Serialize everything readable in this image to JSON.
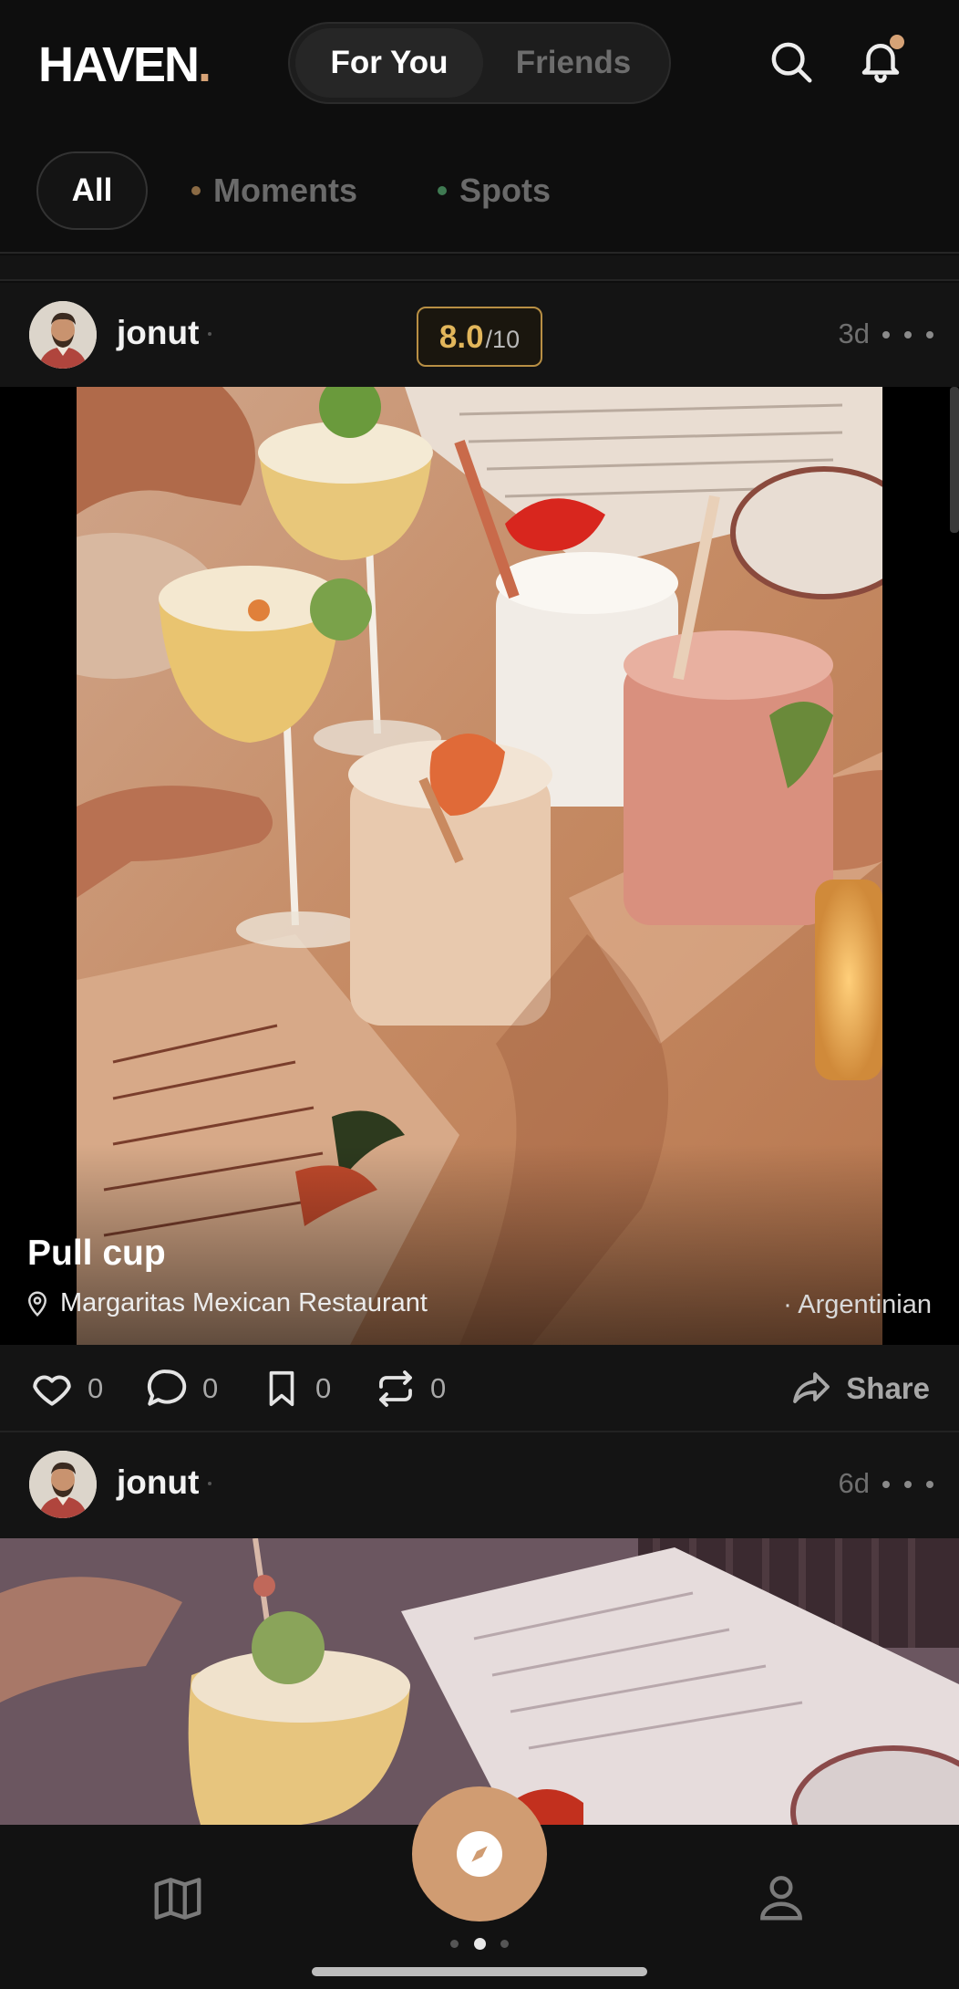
{
  "app": {
    "logo_text": "HAVEN",
    "logo_dot": ".",
    "accent": "#d6a276"
  },
  "header": {
    "tabs": [
      {
        "label": "For You",
        "active": true
      },
      {
        "label": "Friends",
        "active": false
      }
    ],
    "icons": [
      "search-icon",
      "bell-icon"
    ],
    "notification_dot": true
  },
  "filters": [
    {
      "label": "All",
      "active": true
    },
    {
      "label": "Moments",
      "bullet_color": "#8a6a44"
    },
    {
      "label": "Spots",
      "bullet_color": "#3f7a52"
    }
  ],
  "posts": [
    {
      "username": "jonut",
      "rating": {
        "score": "8.0",
        "outof": "/10"
      },
      "time": "3d",
      "dish": "Pull cup",
      "place": "Margaritas Mexican Restaurant",
      "cuisine": "· Argentinian",
      "actions": {
        "likes": "0",
        "comments": "0",
        "saves": "0",
        "reposts": "0"
      },
      "share_label": "Share"
    },
    {
      "username": "jonut",
      "time": "6d"
    }
  ],
  "bottom_nav": {
    "items": [
      "map-icon",
      "compass-icon",
      "profile-icon"
    ],
    "active_page": 2,
    "page_count": 3
  }
}
